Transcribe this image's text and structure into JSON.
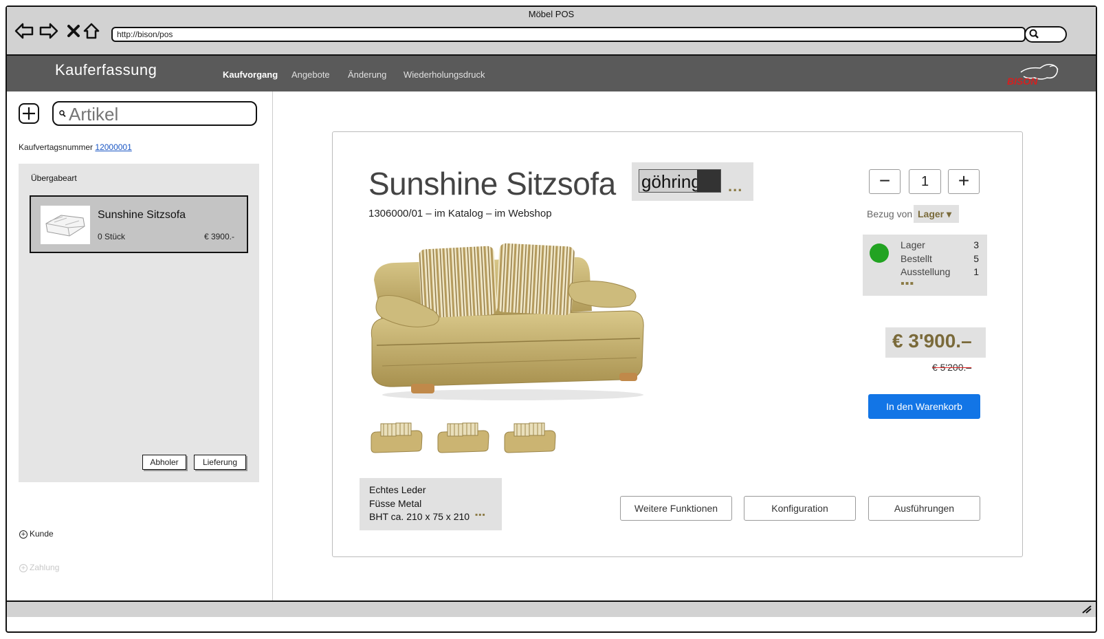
{
  "window": {
    "title": "Möbel POS",
    "url": "http://bison/pos"
  },
  "nav_icons": [
    "back-arrow-icon",
    "forward-arrow-icon",
    "close-x-icon",
    "home-icon"
  ],
  "app": {
    "title": "Kauferfassung",
    "nav": [
      "Kaufvorgang",
      "Angebote",
      "Änderung",
      "Wiederholungsdruck"
    ],
    "logo_text": "BISON"
  },
  "sidebar": {
    "search_placeholder": "Artikel",
    "contract_label": "Kaufvertagsnummer",
    "contract_number": "12000001",
    "handover_title": "Übergabeart",
    "cart_item": {
      "name": "Sunshine Sitzsofa",
      "qty": "0 Stück",
      "price": "€ 3900.-"
    },
    "handover_buttons": [
      "Abholer",
      "Lieferung"
    ],
    "steps": [
      {
        "label": "Kunde",
        "active": true
      },
      {
        "label": "Zahlung",
        "active": false
      }
    ]
  },
  "product": {
    "title": "Sunshine Sitzsofa",
    "brand": "göhring",
    "brand_more": "...",
    "meta": "1306000/01  –  im Katalog  –  im Webshop",
    "attributes": [
      "Echtes Leder",
      "Füsse Metal",
      "BHT ca. 210 x 75 x 210"
    ],
    "attributes_more": "▪▪▪",
    "quantity": "1",
    "minus_label": "−",
    "plus_label": "+",
    "source_label": "Bezug von",
    "source_value": "Lager ▾",
    "stock": [
      {
        "label": "Lager",
        "value": "3"
      },
      {
        "label": "Bestellt",
        "value": "5"
      },
      {
        "label": "Ausstellung",
        "value": "1"
      }
    ],
    "stock_more": "▪▪▪",
    "stock_status_color": "#22a322",
    "price": "€ 3'900.–",
    "old_price": "€ 5'200.–",
    "cart_button": "In den Warenkorb",
    "actions": [
      "Weitere Funktionen",
      "Konfiguration",
      "Ausführungen"
    ],
    "accent_color": "#1275e6"
  }
}
